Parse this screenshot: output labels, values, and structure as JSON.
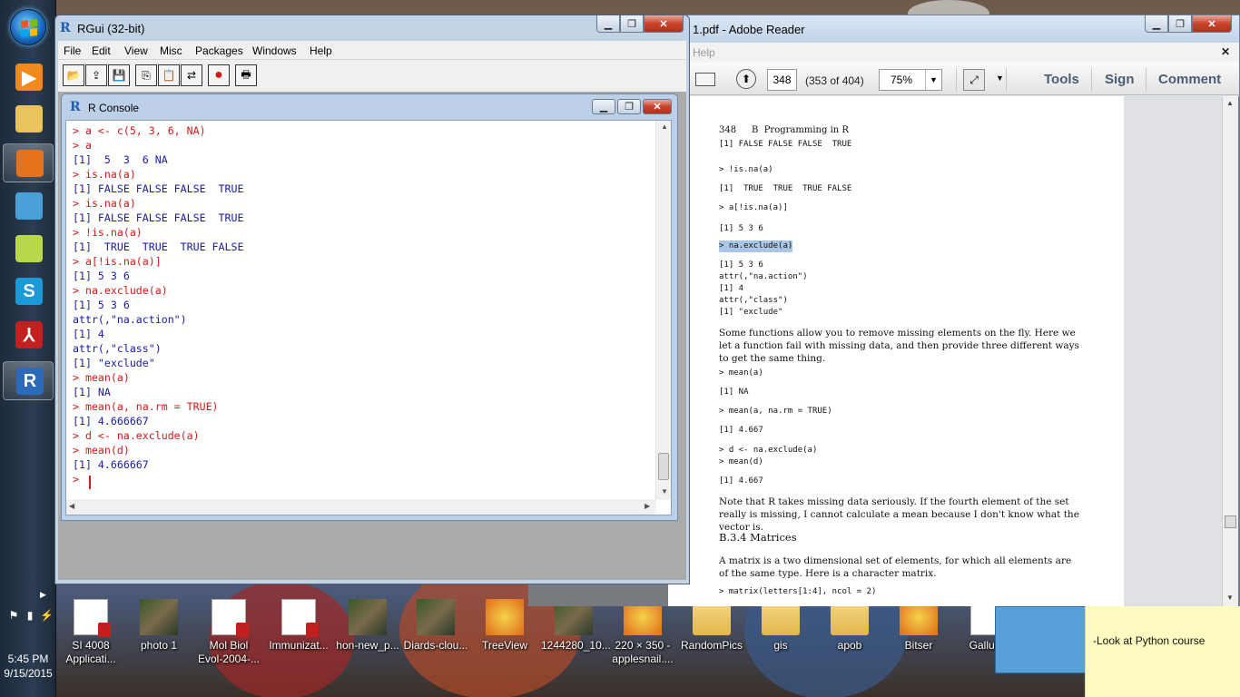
{
  "taskbar": {
    "items": [
      {
        "name": "media-player-icon",
        "glyph": "▶",
        "color": "#f08a1c"
      },
      {
        "name": "explorer-icon",
        "glyph": "",
        "color": "#e8c45a"
      },
      {
        "name": "firefox-icon",
        "glyph": "",
        "color": "#e8721c"
      },
      {
        "name": "notes-icon",
        "glyph": "",
        "color": "#4aa0d8"
      },
      {
        "name": "sticky-notes-icon",
        "glyph": "",
        "color": "#b7d84a"
      },
      {
        "name": "skype-icon",
        "glyph": "S",
        "color": "#1a9ad8"
      },
      {
        "name": "adobe-reader-icon",
        "glyph": "⅄",
        "color": "#c21f1f"
      },
      {
        "name": "r-icon",
        "glyph": "R",
        "color": "#2a6ab8"
      }
    ],
    "clock_time": "5:45 PM",
    "clock_date": "9/15/2015"
  },
  "rgui": {
    "title": "RGui (32-bit)",
    "menu": [
      "File",
      "Edit",
      "View",
      "Misc",
      "Packages",
      "Windows",
      "Help"
    ],
    "toolbar": [
      "open-script-icon",
      "load-workspace-icon",
      "save-workspace-icon",
      "copy-icon",
      "paste-icon",
      "copy-paste-icon",
      "stop-icon",
      "print-icon"
    ],
    "console": {
      "title": "R Console",
      "lines": [
        {
          "t": "in",
          "text": "> a <- c(5, 3, 6, NA)"
        },
        {
          "t": "in",
          "text": "> a"
        },
        {
          "t": "out",
          "text": "[1]  5  3  6 NA"
        },
        {
          "t": "in",
          "text": "> is.na(a)"
        },
        {
          "t": "out",
          "text": "[1] FALSE FALSE FALSE  TRUE"
        },
        {
          "t": "in",
          "text": "> is.na(a)"
        },
        {
          "t": "out",
          "text": "[1] FALSE FALSE FALSE  TRUE"
        },
        {
          "t": "in",
          "text": "> !is.na(a)"
        },
        {
          "t": "out",
          "text": "[1]  TRUE  TRUE  TRUE FALSE"
        },
        {
          "t": "in",
          "text": "> a[!is.na(a)]"
        },
        {
          "t": "out",
          "text": "[1] 5 3 6"
        },
        {
          "t": "in",
          "text": "> na.exclude(a)"
        },
        {
          "t": "out",
          "text": "[1] 5 3 6"
        },
        {
          "t": "out",
          "text": "attr(,\"na.action\")"
        },
        {
          "t": "out",
          "text": "[1] 4"
        },
        {
          "t": "out",
          "text": "attr(,\"class\")"
        },
        {
          "t": "out",
          "text": "[1] \"exclude\""
        },
        {
          "t": "in",
          "text": "> mean(a)"
        },
        {
          "t": "out",
          "text": "[1] NA"
        },
        {
          "t": "in",
          "text": "> mean(a, na.rm = TRUE)"
        },
        {
          "t": "out",
          "text": "[1] 4.666667"
        },
        {
          "t": "in",
          "text": "> d <- na.exclude(a)"
        },
        {
          "t": "in",
          "text": "> mean(d)"
        },
        {
          "t": "out",
          "text": "[1] 4.666667"
        },
        {
          "t": "in",
          "text": "> "
        }
      ]
    }
  },
  "reader": {
    "title": "1.pdf - Adobe Reader",
    "menu_help": "Help",
    "page_number": "348",
    "page_of": "(353 of 404)",
    "zoom": "75%",
    "links": [
      "Tools",
      "Sign",
      "Comment"
    ],
    "page": {
      "header_num": "348",
      "header_title": "B  Programming in R",
      "blocks": [
        {
          "k": "code",
          "text": "[1] FALSE FALSE FALSE  TRUE"
        },
        {
          "k": "code",
          "text": "> !is.na(a)"
        },
        {
          "k": "code",
          "text": "[1]  TRUE  TRUE  TRUE FALSE"
        },
        {
          "k": "code",
          "text": "> a[!is.na(a)]"
        },
        {
          "k": "code",
          "text": "[1] 5 3 6"
        },
        {
          "k": "code",
          "text": "> na.exclude(a)"
        },
        {
          "k": "code",
          "text": "[1] 5 3 6"
        },
        {
          "k": "code",
          "text": "attr(,\"na.action\")"
        },
        {
          "k": "code",
          "text": "[1] 4"
        },
        {
          "k": "code",
          "text": "attr(,\"class\")"
        },
        {
          "k": "code",
          "text": "[1] \"exclude\""
        },
        {
          "k": "prose",
          "text": "Some functions allow you to remove missing elements on the fly. Here we let a function fail with missing data, and then provide three different ways to get the same thing."
        },
        {
          "k": "code",
          "text": "> mean(a)"
        },
        {
          "k": "code",
          "text": "[1] NA"
        },
        {
          "k": "code",
          "text": "> mean(a, na.rm = TRUE)"
        },
        {
          "k": "code",
          "text": "[1] 4.667"
        },
        {
          "k": "code",
          "text": "> d <- na.exclude(a)"
        },
        {
          "k": "code",
          "text": "> mean(d)"
        },
        {
          "k": "code",
          "text": "[1] 4.667"
        },
        {
          "k": "prose",
          "text": "Note that R takes missing data seriously. If the fourth element of the set really is missing, I cannot calculate a mean because I don't know what the vector is."
        },
        {
          "k": "heading",
          "text": "B.3.4 Matrices"
        },
        {
          "k": "prose",
          "text": "A matrix is a two dimensional set of elements, for which all elements are of the same type. Here is a character matrix."
        },
        {
          "k": "code",
          "text": "> matrix(letters[1:4], ncol = 2)"
        }
      ]
    }
  },
  "desktop_icons": [
    {
      "label": "SI 4008 Applicati...",
      "kind": "doc"
    },
    {
      "label": "photo 1",
      "kind": "photo"
    },
    {
      "label": "Mol Biol Evol-2004-...",
      "kind": "doc"
    },
    {
      "label": "Immunizat...",
      "kind": "doc"
    },
    {
      "label": "hon-new_p...",
      "kind": "photo"
    },
    {
      "label": "Diards-clou...",
      "kind": "photo"
    },
    {
      "label": "TreeView",
      "kind": "app"
    },
    {
      "label": "1244280_10...",
      "kind": "photo"
    },
    {
      "label": "220 × 350 - applesnail....",
      "kind": "app"
    },
    {
      "label": "RandomPics",
      "kind": "folder"
    },
    {
      "label": "gis",
      "kind": "folder"
    },
    {
      "label": "apob",
      "kind": "folder"
    },
    {
      "label": "Bitser",
      "kind": "app"
    },
    {
      "label": "Gallus_",
      "kind": "doc"
    }
  ],
  "sticky_note": {
    "text": "-Look at Python course"
  }
}
